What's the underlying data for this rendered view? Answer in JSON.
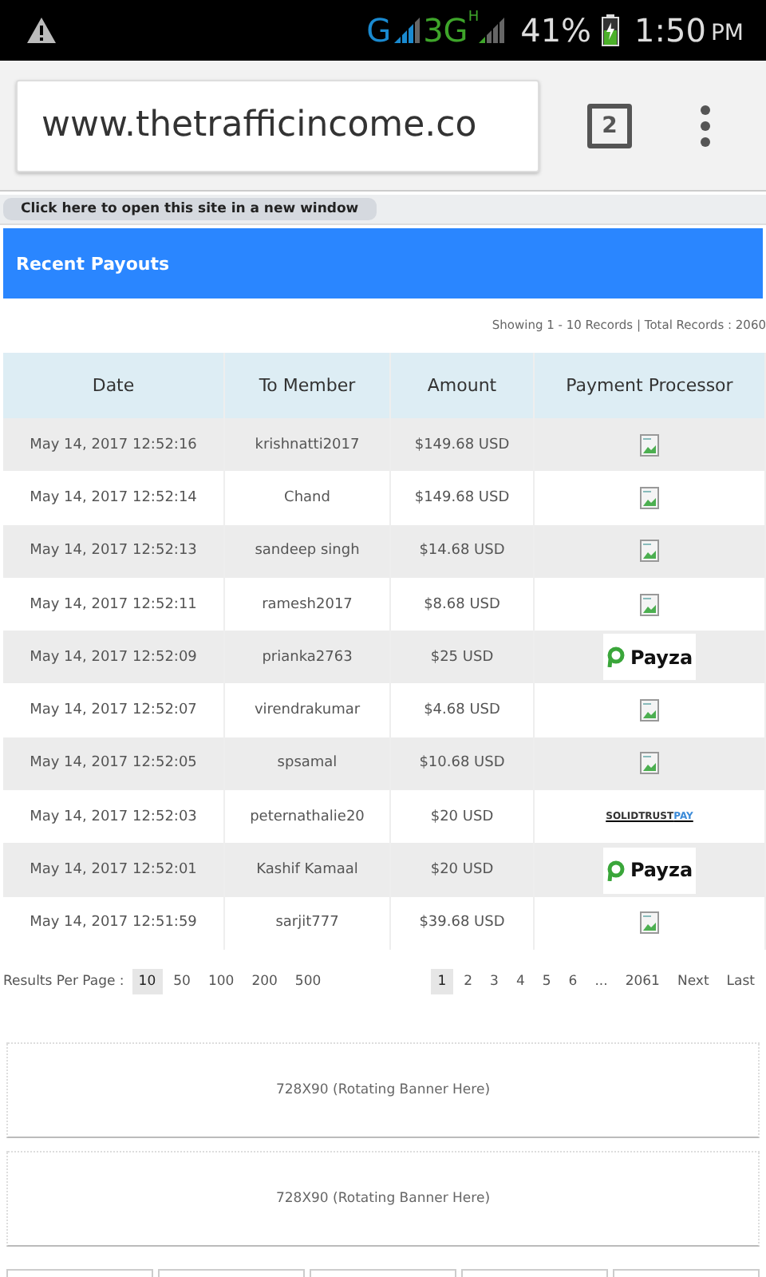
{
  "status_bar": {
    "network_1": "G",
    "network_2": "3G",
    "network_2_sub": "H",
    "battery": "41%",
    "time": "1:50",
    "ampm": "PM"
  },
  "browser": {
    "url": "www.thetrafficincome.co",
    "tab_count": "2"
  },
  "new_window_link": "Click here to open this site in a new window",
  "panel_title": "Recent Payouts",
  "records_info": "Showing 1 - 10 Records | Total Records : 2060",
  "table": {
    "columns": [
      "Date",
      "To Member",
      "Amount",
      "Payment Processor"
    ],
    "rows": [
      {
        "date": "May 14, 2017 12:52:16",
        "member": "krishnatti2017",
        "amount": "$149.68 USD",
        "processor": {
          "kind": "broken"
        }
      },
      {
        "date": "May 14, 2017 12:52:14",
        "member": "Chand",
        "amount": "$149.68 USD",
        "processor": {
          "kind": "broken"
        }
      },
      {
        "date": "May 14, 2017 12:52:13",
        "member": "sandeep singh",
        "amount": "$14.68 USD",
        "processor": {
          "kind": "broken"
        }
      },
      {
        "date": "May 14, 2017 12:52:11",
        "member": "ramesh2017",
        "amount": "$8.68 USD",
        "processor": {
          "kind": "broken"
        }
      },
      {
        "date": "May 14, 2017 12:52:09",
        "member": "prianka2763",
        "amount": "$25 USD",
        "processor": {
          "kind": "payza",
          "label": "Payza"
        }
      },
      {
        "date": "May 14, 2017 12:52:07",
        "member": "virendrakumar",
        "amount": "$4.68 USD",
        "processor": {
          "kind": "broken"
        }
      },
      {
        "date": "May 14, 2017 12:52:05",
        "member": "spsamal",
        "amount": "$10.68 USD",
        "processor": {
          "kind": "broken"
        }
      },
      {
        "date": "May 14, 2017 12:52:03",
        "member": "peternathalie20",
        "amount": "$20 USD",
        "processor": {
          "kind": "solidtrust",
          "label": "SOLIDTRUST",
          "label_2": "PAY"
        }
      },
      {
        "date": "May 14, 2017 12:52:01",
        "member": "Kashif Kamaal",
        "amount": "$20 USD",
        "processor": {
          "kind": "payza",
          "label": "Payza"
        }
      },
      {
        "date": "May 14, 2017 12:51:59",
        "member": "sarjit777",
        "amount": "$39.68 USD",
        "processor": {
          "kind": "broken"
        }
      }
    ]
  },
  "per_page": {
    "label": "Results Per Page :",
    "options": [
      {
        "label": "10",
        "selected": true
      },
      {
        "label": "50",
        "selected": false
      },
      {
        "label": "100",
        "selected": false
      },
      {
        "label": "200",
        "selected": false
      },
      {
        "label": "500",
        "selected": false
      }
    ]
  },
  "pagination": [
    {
      "label": "1",
      "selected": true
    },
    {
      "label": "2",
      "selected": false
    },
    {
      "label": "3",
      "selected": false
    },
    {
      "label": "4",
      "selected": false
    },
    {
      "label": "5",
      "selected": false
    },
    {
      "label": "6",
      "selected": false
    },
    {
      "label": "...",
      "selected": false
    },
    {
      "label": "2061",
      "selected": false
    },
    {
      "label": "Next",
      "selected": false
    },
    {
      "label": "Last",
      "selected": false
    }
  ],
  "banners": [
    "728X90 (Rotating Banner Here)",
    "728X90 (Rotating Banner Here)"
  ]
}
